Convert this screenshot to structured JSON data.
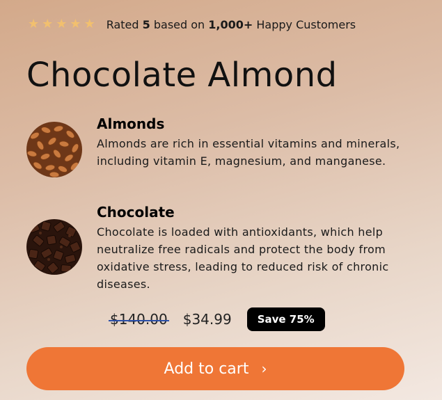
{
  "rating": {
    "stars": 5,
    "icon": "star-icon",
    "star_color": "#f2c06e",
    "prefix": "Rated ",
    "score": "5",
    "middle": " based on ",
    "count": "1,000+",
    "suffix": " Happy Customers"
  },
  "product": {
    "title": "Chocolate Almond"
  },
  "features": [
    {
      "heading": "Almonds",
      "icon": "almonds-image",
      "lines": [
        "Almonds are rich in essential vitamins and minerals,",
        "including vitamin E, magnesium, and manganese."
      ]
    },
    {
      "heading": "Chocolate",
      "icon": "chocolate-image",
      "lines": [
        "Chocolate is loaded with antioxidants, which help neutralize free radicals and protect the body from oxidative stress, leading to reduced risk of chronic diseases."
      ]
    }
  ],
  "pricing": {
    "original": "$140.00",
    "sale": "$34.99",
    "badge": "Save 75%"
  },
  "cta": {
    "label": "Add to cart",
    "icon": "chevron-right-icon",
    "color": "#ef7636"
  }
}
